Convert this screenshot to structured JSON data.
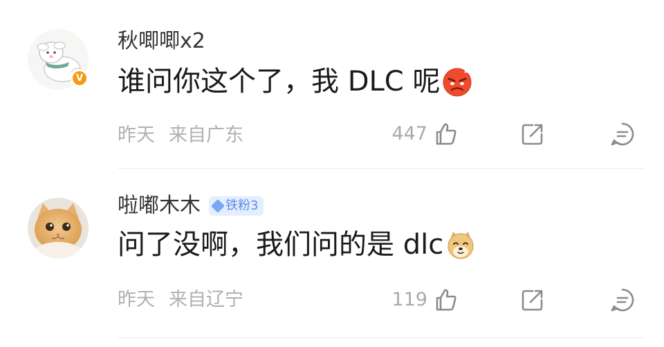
{
  "comments": [
    {
      "username": "秋唧唧",
      "username_suffix": "x2",
      "verified_badge": "V",
      "text": "谁问你这个了，我 DLC 呢",
      "emoji": "angry-face-emoji",
      "time": "昨天",
      "location": "来自广东",
      "likes": "447",
      "icons": [
        "like-icon",
        "share-icon",
        "reply-icon"
      ]
    },
    {
      "username": "啦嘟木木",
      "fan_badge": "铁粉3",
      "text": "问了没啊，我们问的是 dlc",
      "emoji": "doge-emoji",
      "time": "昨天",
      "location": "来自辽宁",
      "likes": "119",
      "icons": [
        "like-icon",
        "share-icon",
        "reply-icon"
      ]
    }
  ],
  "colors": {
    "verified_badge": "#f59a18",
    "fan_badge_bg": "#e3eeff",
    "fan_badge_text": "#5d8de6",
    "meta_text": "#b0b0b0"
  }
}
